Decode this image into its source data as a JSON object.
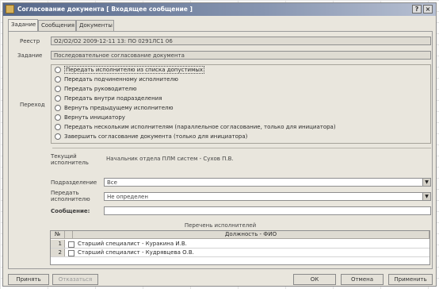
{
  "window": {
    "title": "Согласование документа [ Входящее сообщение ]",
    "controls": {
      "help": "?",
      "close": "×"
    }
  },
  "tabs": [
    {
      "label": "Задание",
      "active": true
    },
    {
      "label": "Сообщения",
      "active": false
    },
    {
      "label": "Документы",
      "active": false
    }
  ],
  "form": {
    "route_label": "Реестр",
    "route_value": "О2/О2/О2 2009-12-11 13: ПО 0291ЛС1 06",
    "task_label": "Задание",
    "task_value": "Последовательное согласование документа",
    "choice_label": "Переход",
    "options": [
      "Передать исполнителю из списка допустимых",
      "Передать подчиненному исполнителю",
      "Передать руководителю",
      "Передать внутри подразделения",
      "Вернуть предыдущему исполнителю",
      "Вернуть инициатору",
      "Передать нескольким исполнителям (параллельное согласование, только для инициатора)",
      "Завершить согласование документа (только для инициатора)"
    ],
    "current_label": "Текущий исполнитель",
    "current_value": "Начальник отдела ПЛМ систем - Сухов П.В.",
    "dept_label": "Подразделение",
    "dept_value": "Все",
    "assign_label": "Передать исполнителю",
    "assign_value": "Не определен",
    "message_label": "Сообщение:",
    "message_value": ""
  },
  "executors": {
    "title": "Перечень исполнителей",
    "columns": [
      "№",
      "Должность - ФИО"
    ],
    "rows": [
      {
        "num": "1",
        "text": "Старший специалист - Куракина И.В."
      },
      {
        "num": "2",
        "text": "Старший специалист - Кудрявцева О.В."
      }
    ]
  },
  "buttons": {
    "accept": "Принять",
    "return": "Отказаться",
    "ok": "ОК",
    "cancel": "Отмена",
    "apply": "Применить"
  }
}
